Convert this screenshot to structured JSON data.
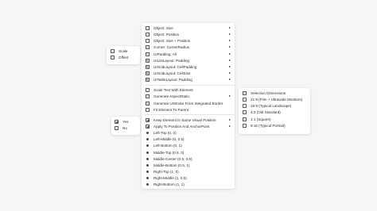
{
  "scale_menu": {
    "items": [
      {
        "label": "Scale",
        "icon": "resize-icon"
      },
      {
        "label": "Offset",
        "icon": "offset-icon"
      }
    ]
  },
  "yesno_menu": {
    "items": [
      {
        "label": "Yes",
        "icon": "checkbox-checked-icon"
      },
      {
        "label": "No",
        "icon": "checkbox-icon"
      }
    ]
  },
  "main_menu": {
    "group1": [
      {
        "label": "Object: Size",
        "icon": "object-size-icon"
      },
      {
        "label": "Object: Position",
        "icon": "object-position-icon"
      },
      {
        "label": "Object: Size + Position",
        "icon": "object-size-position-icon"
      },
      {
        "label": "Corner: CornerRadius",
        "icon": "corner-radius-icon"
      },
      {
        "label": "UIPadding: All",
        "icon": "padding-icon"
      },
      {
        "label": "UIListLayout: Padding",
        "icon": "list-layout-icon"
      },
      {
        "label": "UIGridLayout: CellPadding",
        "icon": "grid-layout-icon"
      },
      {
        "label": "UIGridLayout: CellSize",
        "icon": "grid-cellsize-icon"
      },
      {
        "label": "UITableLayout: Padding",
        "icon": "table-layout-icon"
      }
    ],
    "group2": [
      {
        "label": "Scale Text With Element",
        "icon": "text-scale-icon"
      },
      {
        "label": "Generate AspectRatio",
        "icon": "aspect-ratio-icon"
      },
      {
        "label": "Generate UIStroke From Integrated Border",
        "icon": "stroke-icon"
      },
      {
        "label": "Fit Element To Parent",
        "icon": "fit-parent-icon"
      }
    ],
    "group3": [
      {
        "label": "Keep Element In Same Visual Position",
        "icon": "keep-position-icon"
      },
      {
        "label": "Apply To Position And AnchorPoint",
        "icon": "anchor-point-icon"
      },
      {
        "label": "Left-Top (0, 0)",
        "icon": "anchor-dot-icon"
      },
      {
        "label": "Left-Middle (0, 0.5)",
        "icon": "anchor-dot-icon"
      },
      {
        "label": "Left-Bottom (0, 1)",
        "icon": "anchor-dot-icon"
      },
      {
        "label": "Middle-Top (0.5, 0)",
        "icon": "anchor-dot-icon"
      },
      {
        "label": "Middle-Center (0.5, 0.5)",
        "icon": "anchor-dot-icon"
      },
      {
        "label": "Middle-Bottom (0.5, 1)",
        "icon": "anchor-dot-icon"
      },
      {
        "label": "Right-Top (1, 0)",
        "icon": "anchor-dot-icon"
      },
      {
        "label": "Right-Middle (1, 0.5)",
        "icon": "anchor-dot-icon"
      },
      {
        "label": "Right-Bottom (1, 1)",
        "icon": "anchor-dot-icon"
      }
    ]
  },
  "dimensions_menu": {
    "items": [
      {
        "label": "Selection Dimensions",
        "icon": "selection-icon"
      },
      {
        "label": "21:9 (Film + Ultrawide Monitors)",
        "icon": "ratio-icon"
      },
      {
        "label": "16:9 (Typical Landscape)",
        "icon": "ratio-icon"
      },
      {
        "label": "4:3 (Old Standard)",
        "icon": "ratio-icon"
      },
      {
        "label": "1:1 (Square)",
        "icon": "ratio-icon"
      },
      {
        "label": "9:16 (Typical Portrait)",
        "icon": "ratio-icon"
      }
    ]
  }
}
